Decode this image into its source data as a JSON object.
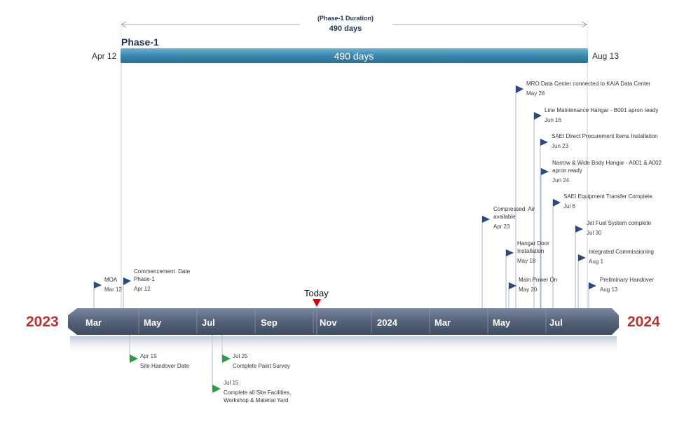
{
  "duration": {
    "caption": "(Phase-1 Duration)",
    "value": "490 days"
  },
  "phase": {
    "name": "Phase-1",
    "bar_label": "490 days",
    "start": "Apr 12",
    "end": "Aug 13"
  },
  "today": {
    "label": "Today"
  },
  "years": {
    "left": "2023",
    "right": "2024"
  },
  "months": [
    "Mar",
    "May",
    "Jul",
    "Sep",
    "Nov",
    "2024",
    "Mar",
    "May",
    "Jul"
  ],
  "milestones_above": [
    {
      "title": "MOA",
      "date": "Mar 12"
    },
    {
      "title": "Commencement  Date\nPhase-1",
      "date": "Apr 12"
    },
    {
      "title": "MRO Data Center connected to KAIA Data Center",
      "date": "May 28"
    },
    {
      "title": "Line Maintenance  Hangar - B001 apron ready",
      "date": "Jun 16"
    },
    {
      "title": "SAEI Direct Procurement Items Installation",
      "date": "Jun 23"
    },
    {
      "title": "Narrow & Wide Body Hangar - A001 & A002\napron ready",
      "date": "Jun 24"
    },
    {
      "title": "SAEI Equipment Transfer  Complete",
      "date": "Jul 6"
    },
    {
      "title": "Compressed  Air\navailable",
      "date": "Apr 23"
    },
    {
      "title": "Jet Fuel System complete",
      "date": "Jul 30"
    },
    {
      "title": "Hangar Door\nInstallation",
      "date": "May 18"
    },
    {
      "title": "Integrated  Commissioning",
      "date": "Aug 1"
    },
    {
      "title": "Main Power On",
      "date": "May 20"
    },
    {
      "title": "Preliminary  Handover",
      "date": "Aug 13"
    }
  ],
  "milestones_below": [
    {
      "title": "Site Handover Date",
      "date": "Apr 19"
    },
    {
      "title": "Complete  Paint Survey",
      "date": "Jul 25"
    },
    {
      "title": "Complete all Site Facilities,\nWorkshop & Material Yard",
      "date": "Jul 15"
    }
  ],
  "colors": {
    "phase_bar": "#3a87ad",
    "timeline": "#5a6780",
    "year": "#b83232",
    "flag_above": "#2c4a7a",
    "flag_below": "#2e9e46",
    "today_marker": "#e00000",
    "line": "#7f97b5"
  }
}
